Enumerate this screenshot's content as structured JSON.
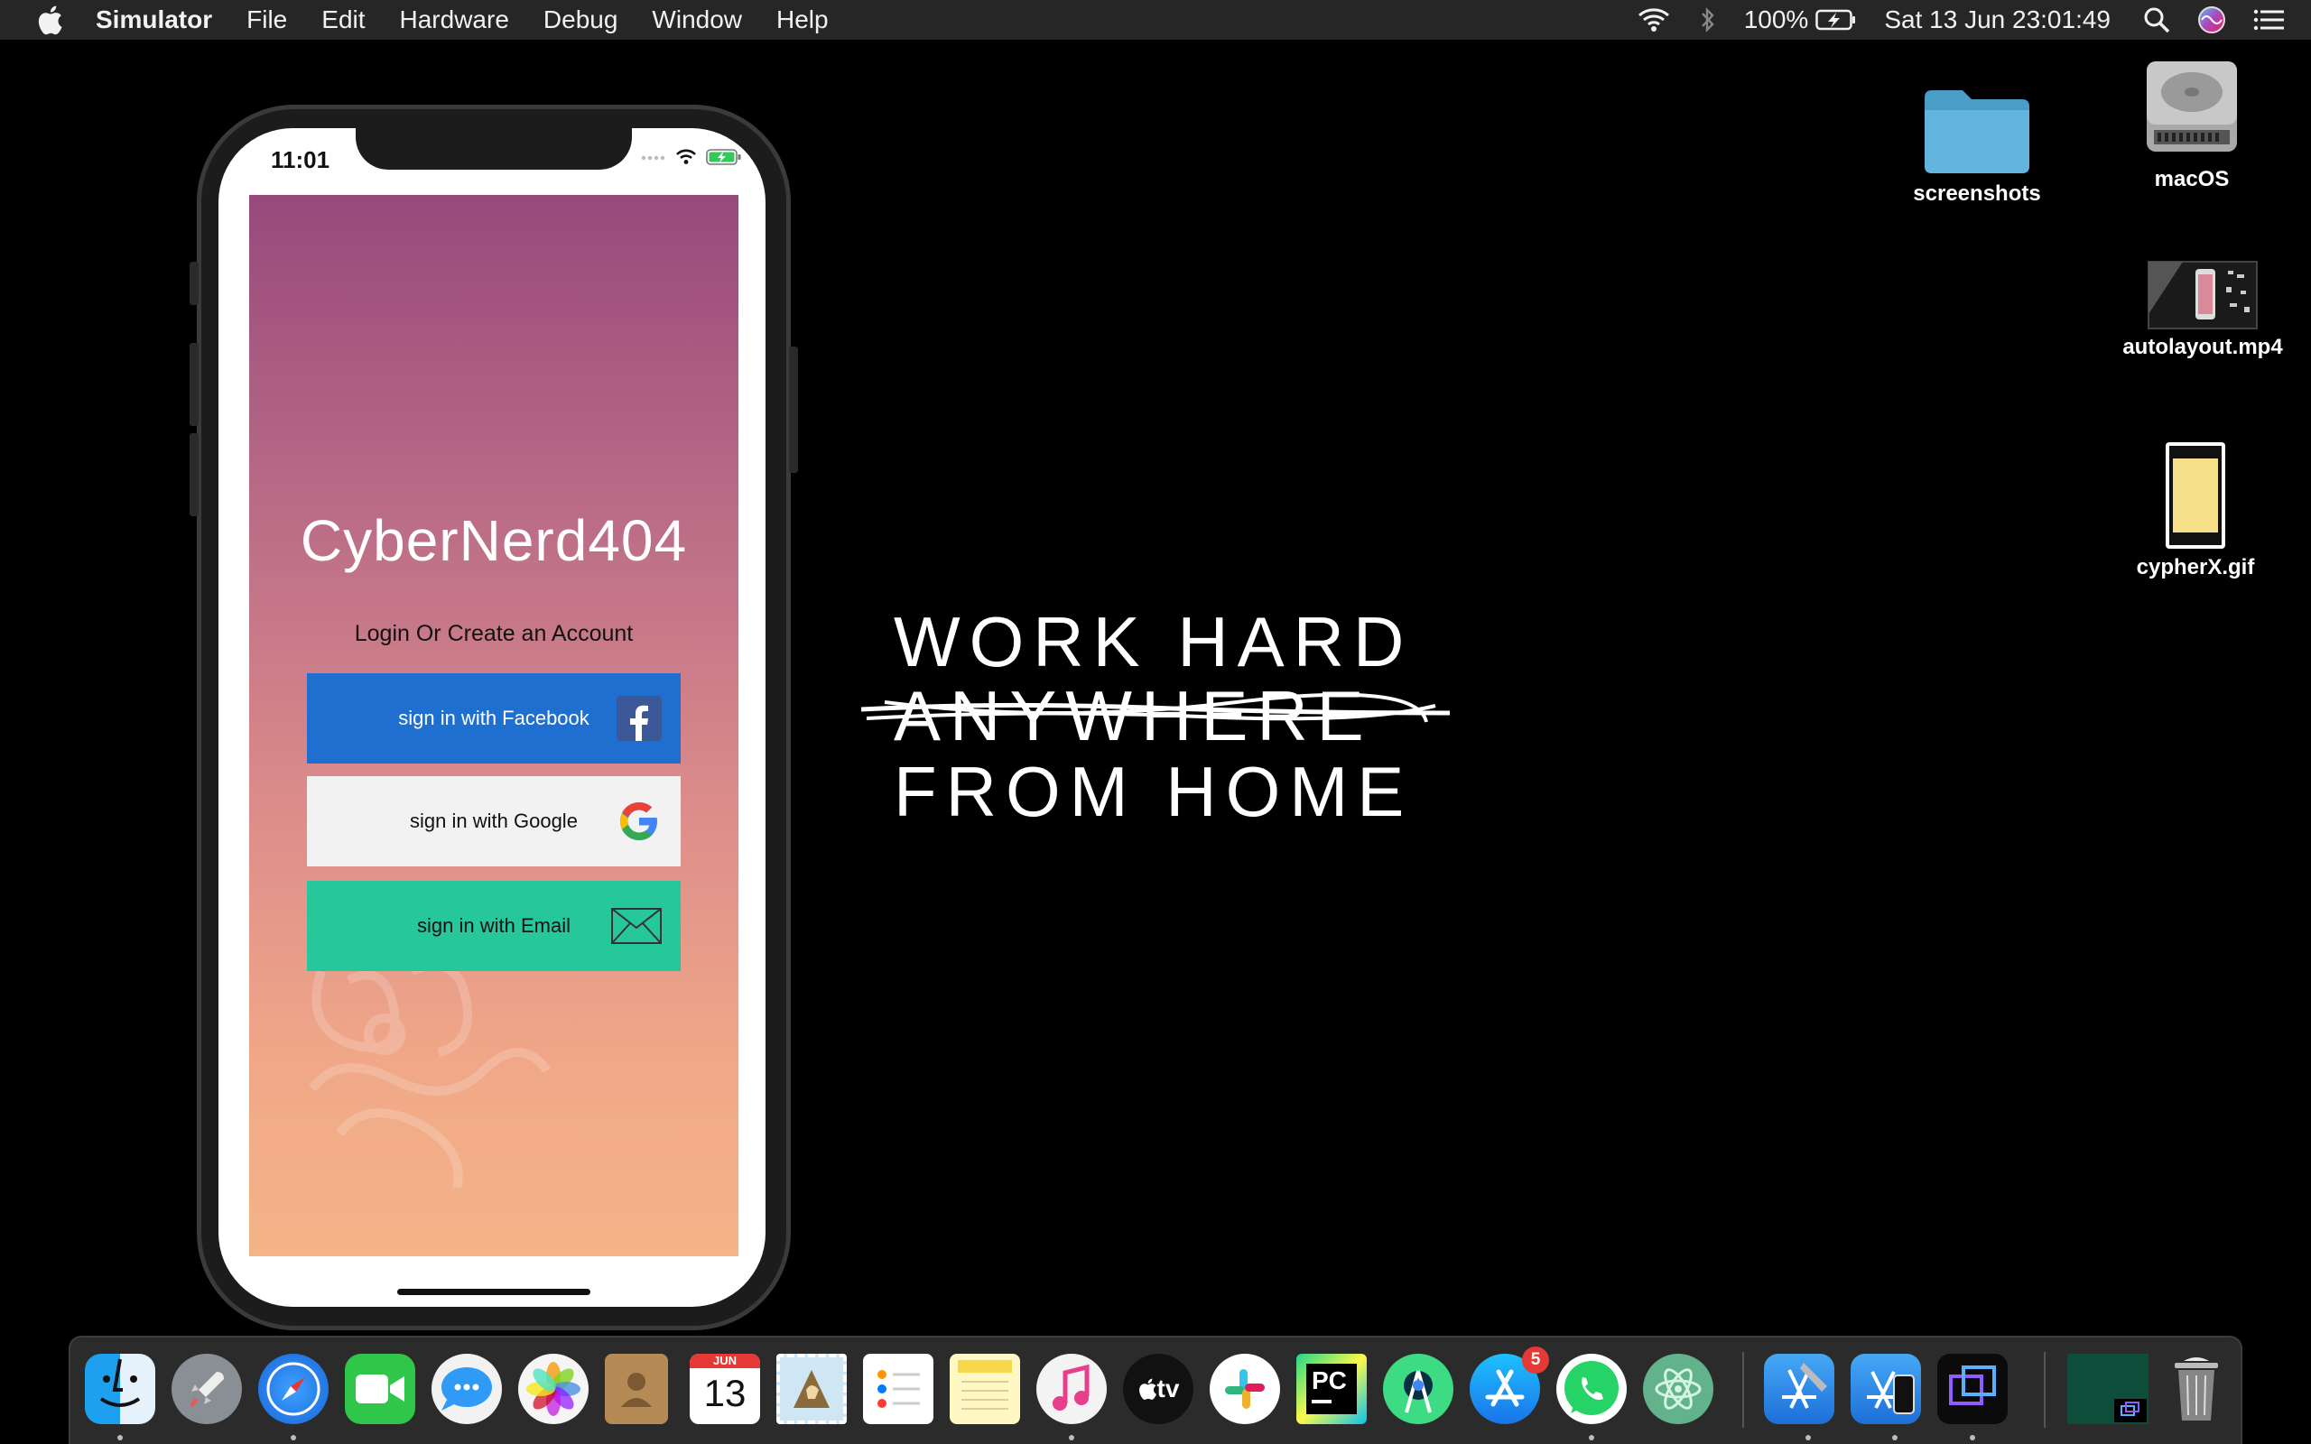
{
  "menubar": {
    "app_name": "Simulator",
    "items": [
      "File",
      "Edit",
      "Hardware",
      "Debug",
      "Window",
      "Help"
    ],
    "battery": "100%",
    "clock": "Sat 13 Jun  23:01:49"
  },
  "simulator": {
    "status_time": "11:01",
    "app": {
      "title": "CyberNerd404",
      "subtitle": "Login Or Create an Account",
      "buttons": {
        "facebook": "sign in with Facebook",
        "google": "sign in with Google",
        "email": "sign in with Email"
      }
    }
  },
  "wallpaper": {
    "line1": "WORK HARD",
    "line2": "ANYWHERE",
    "line3": "FROM HOME"
  },
  "desktop": {
    "items": [
      {
        "label": "screenshots",
        "icon": "folder-icon"
      },
      {
        "label": "macOS",
        "icon": "hard-drive-icon"
      },
      {
        "label": "autolayout.mp4",
        "icon": "video-file-icon"
      },
      {
        "label": "cypherX.gif",
        "icon": "gif-file-icon"
      }
    ]
  },
  "dock": {
    "calendar_month": "JUN",
    "calendar_day": "13",
    "appstore_badge": "5",
    "tv_label": "tv",
    "pycharm_label": "PC"
  }
}
